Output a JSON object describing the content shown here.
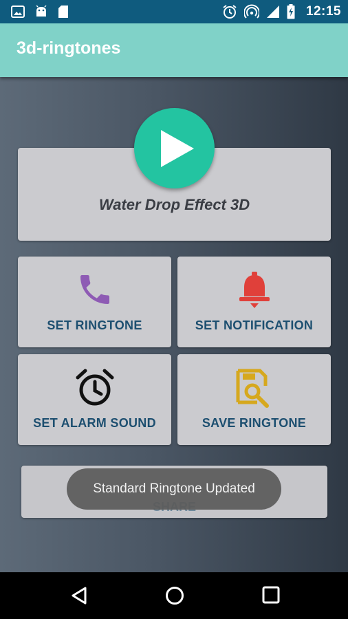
{
  "status_bar": {
    "time": "12:15",
    "left_icons": [
      "image-icon",
      "android-icon",
      "sd-card-icon"
    ],
    "right_icons": [
      "alarm-icon",
      "hotspot-icon",
      "signal-icon",
      "battery-charging-icon"
    ]
  },
  "app_bar": {
    "title": "3d-ringtones"
  },
  "sound": {
    "title": "Water Drop Effect 3D"
  },
  "actions": [
    {
      "label": "SET RINGTONE",
      "icon": "phone-icon",
      "icon_color": "#8e5bb4"
    },
    {
      "label": "SET NOTIFICATION",
      "icon": "bell-icon",
      "icon_color": "#e0403a"
    },
    {
      "label": "SET ALARM SOUND",
      "icon": "alarm-clock-icon",
      "icon_color": "#111111"
    },
    {
      "label": "SAVE RINGTONE",
      "icon": "save-search-icon",
      "icon_color": "#d6a81e"
    }
  ],
  "share": {
    "label": "SHARE"
  },
  "toast": {
    "text": "Standard Ringtone Updated"
  },
  "nav": {
    "icons": [
      "back-icon",
      "home-icon",
      "recents-icon"
    ]
  },
  "colors": {
    "status_bar": "#0f5b7e",
    "app_bar": "#80d2c8",
    "play_button": "#23c4a1",
    "label_text": "#1d4f70"
  }
}
